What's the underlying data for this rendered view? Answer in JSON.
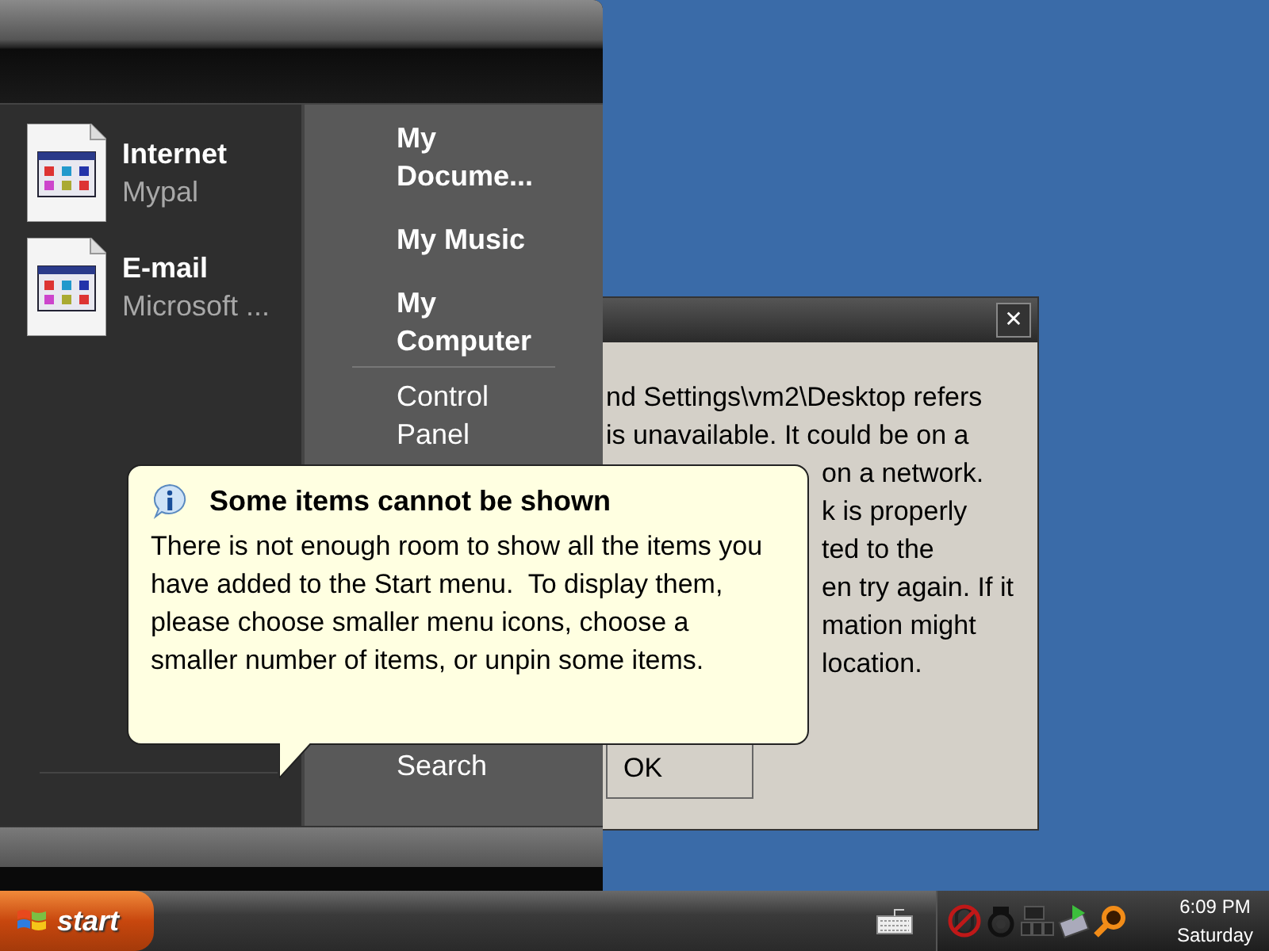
{
  "dialog": {
    "close_label": "✕",
    "lines": [
      {
        "text": "nd Settings\\vm2\\Desktop refers",
        "covered": false
      },
      {
        "text": "is unavailable. It could be on a",
        "covered": false
      },
      {
        "text": "on a network.",
        "covered": true
      },
      {
        "text": "k is properly",
        "covered": true
      },
      {
        "text": "ted to the",
        "covered": true
      },
      {
        "text": "en try again. If it",
        "covered": true
      },
      {
        "text": "mation might",
        "covered": true
      },
      {
        "text": "location.",
        "covered": true
      }
    ],
    "button": "OK"
  },
  "start_menu": {
    "pinned": [
      {
        "title": "Internet",
        "subtitle": "Mypal"
      },
      {
        "title": "E-mail",
        "subtitle": "Microsoft ..."
      }
    ],
    "places": [
      {
        "label": "My Docume...",
        "kind": "bold"
      },
      {
        "label": "My Music",
        "kind": "bold"
      },
      {
        "label": "My Computer",
        "kind": "bold"
      },
      {
        "label": "Control Panel",
        "kind": "plain"
      },
      {
        "label": "Search",
        "kind": "bottom"
      }
    ]
  },
  "balloon": {
    "title": "Some items cannot be shown",
    "text": "There is not enough room to show all the items you have added to the Start menu.  To display them, please choose smaller menu icons, choose a smaller number of items, or unpin some items."
  },
  "taskbar": {
    "start": "start",
    "time": "6:09 PM",
    "day": "Saturday"
  }
}
